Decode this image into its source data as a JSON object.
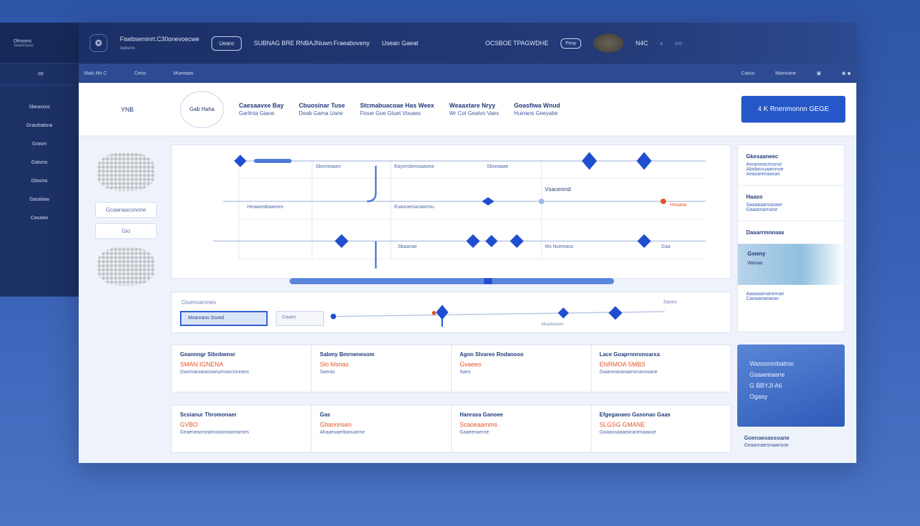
{
  "left_panel": {
    "brand": "Dfmoms",
    "brand_sub": "Seanmeas",
    "counter": "· 00",
    "items": [
      "Sbeaxxns",
      "Grasrbalsna",
      "Grasm",
      "Galsms",
      "Gfasms",
      "Gasaliaw",
      "Caxaaw"
    ]
  },
  "titlebar": {
    "title": "Fisebseminrt.C30onevoecwe",
    "subtitle": "Aeltsrnn",
    "pill": "Uearo",
    "nav1": "SUBNAG BRE RNBAJNuwn:Fraeaboveny",
    "nav2": "Usean Gaeat",
    "right_label": "OCSBOE TPAGWDHE",
    "right_small": "Feuy",
    "misc": "N4C"
  },
  "subbar": {
    "breadcrumb": "Mals  Ms  C",
    "item2": "Ceiss",
    "item3": "Mueeaas",
    "right1": "Caicio",
    "right2": "Maeisane"
  },
  "toolbar": {
    "label": "YNB",
    "circle": "Gab Haha",
    "tools": [
      {
        "title": "Caesaavxe Bay",
        "sub": "Garlinta Giaoe"
      },
      {
        "title": "Cbuosinar Tuse",
        "sub": "Deab Gama Uane"
      },
      {
        "title": "Stcmabuacoae Has Weex",
        "sub": "Ftoue Goe Gtuet Vouaes"
      },
      {
        "title": "Weaaxtare Nryy",
        "sub": "Wr Cot Geatvo Vaex"
      },
      {
        "title": "Goasfiwa Wnud",
        "sub": "Huinans Geeyabe"
      }
    ],
    "primary_button": "4 K Rnenmonnn GEGE"
  },
  "sidebar_thumbs": {
    "input": "Gcaanaaconone",
    "button": "Gio"
  },
  "timeline": {
    "rows": [
      {
        "left": "Sbsmeaaes",
        "mid": "Eayonsbvosaaoea",
        "right": "Sbseaaae"
      },
      {
        "left": "Heaaxeabaamex",
        "mid": "Euaxraesacaamsu",
        "right": "Hosasa"
      },
      {
        "left": "Sbaanae",
        "mid": "Mo Noemaso",
        "right": "Gaa"
      }
    ],
    "callout": "Vsacenmd"
  },
  "scrub": {
    "label": "Gtuenoanmes",
    "tab_active": "Msanrans  Ssxed",
    "tab": "Gaaes",
    "right": "Sanes",
    "marker": "Muanuwsen"
  },
  "cards_row1": [
    {
      "head": "Geannngr Sibnbwnsr",
      "sub": "SMAN IGNENA",
      "desc": "Gwomaniaraosanumrascrineans"
    },
    {
      "head": "Sabmy Bmrnenesom",
      "sub": "Slo Msnas",
      "desc": "Saeras"
    },
    {
      "head": "Agnn Slvareo Rndanooo",
      "sub": "Gvaeeo",
      "desc": "Saes"
    },
    {
      "head": "Lace Goaprnnronoarxa",
      "sub": "ENRMOA SMBS",
      "desc": "Gwanmanaraarnmanosane"
    }
  ],
  "cards_row2": [
    {
      "head": "Scsianur Thromonaer",
      "sub": "GVBO",
      "desc": "Geaeneanneatrnasoneanearnes"
    },
    {
      "head": "Gas",
      "sub": "Gbannnsen",
      "desc": "Ahaaeuaerbanuarme"
    },
    {
      "head": "Hanrasa Ganoee",
      "sub": "Scaoeaamms",
      "desc": "Gaaeenaerne"
    },
    {
      "head": "Efgeganaeo Gasonao Gaas",
      "sub": "SLGSG GMANE",
      "desc": "Gwaasnaaaearanenaaaue"
    }
  ],
  "right_panel": {
    "s1_head": "Gkesaaneec",
    "s1_lines": [
      "Amameasnnsnsl",
      "Abalasnuaamnoe",
      "Aeaoarenaasan"
    ],
    "s2_head": "Haaso",
    "s2_lines": [
      "Saaaaaansasaer",
      "Gaaaosarnase"
    ],
    "s3_head": "Dasarrmnnaas",
    "strip_label": "Gswny",
    "strip_sub": "Wanaa",
    "s4_lines": [
      "Aaaaoamanemae",
      "Caeaaeaeaean"
    ]
  },
  "blue_card": {
    "lines": [
      "Wassonmbatmo",
      "Gsaaeeaane",
      "G BBYJI A6",
      "Ogasy"
    ]
  },
  "footer_note": {
    "head": "Goenaeoassoane",
    "line": "Geaannaesmaansoe"
  },
  "colors": {
    "accent": "#2557c8",
    "timeline_node": "#1f4fd0",
    "warn": "#e0542a"
  }
}
